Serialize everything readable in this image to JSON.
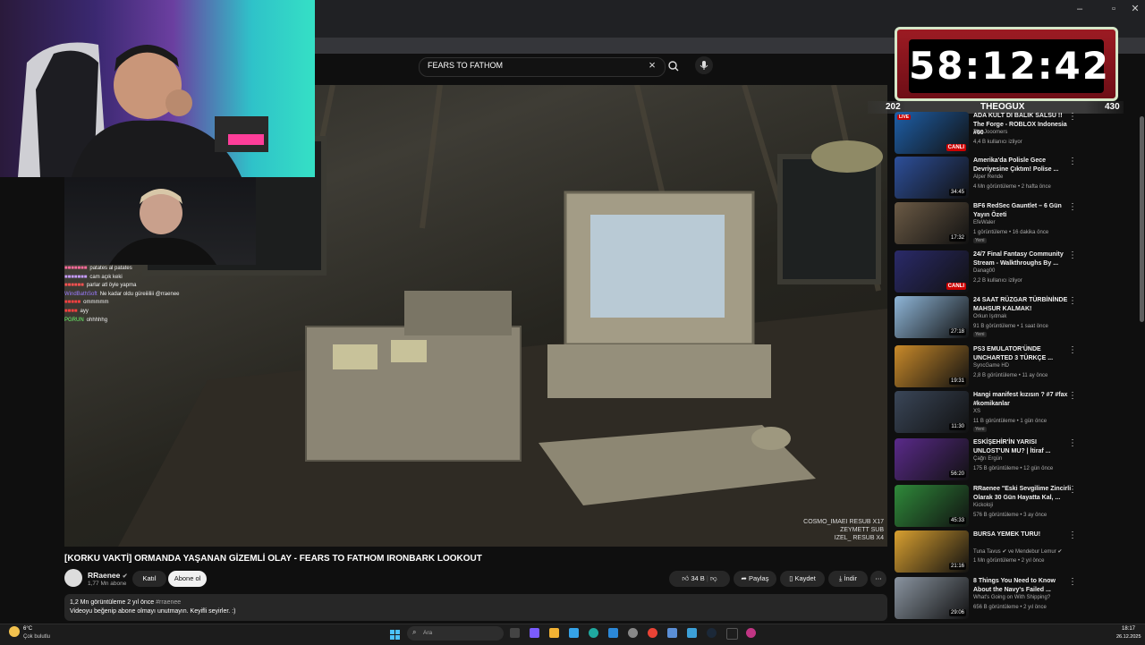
{
  "search": {
    "query": "FEARS TO FATHOM"
  },
  "timer": {
    "time": "58:12:42",
    "left_count": "202",
    "name": "THEOGUX",
    "right_count": "430"
  },
  "chat": [
    {
      "msg": "patates al patates"
    },
    {
      "msg": "cam açık keki"
    },
    {
      "msg": "parlar atl öyle yapma"
    },
    {
      "msg": "Ne kadar oldu güreiiiliii @rraenee",
      "user": "WindBathSoft"
    },
    {
      "msg": "ommmmm"
    },
    {
      "msg": "ayy"
    },
    {
      "msg": "ohhhhhg",
      "user": "PGRUN"
    }
  ],
  "video": {
    "title": "[KORKU VAKTİ] ORMANDA YAŞANAN GİZEMLİ OLAY - FEARS TO FATHOM IRONBARK LOOKOUT",
    "overlay_lines": [
      "COSMO_IMAEI  RESUB X17",
      "ZEYMETT  SUB",
      "IZEL_  RESUB X4"
    ]
  },
  "channel": {
    "name": "RRaenee",
    "subs": "1,77 Mn abone",
    "join": "Katıl",
    "subscribe": "Abone ol"
  },
  "actions": {
    "likes": "34 B",
    "share": "Paylaş",
    "save": "Kaydet",
    "download": "İndir",
    "more": "⋯"
  },
  "description": {
    "stats": "1,2 Mn görüntüleme  2 yıl önce",
    "hashtag": "#rraenee",
    "text": "Videoyu beğenip abone olmayı unutmayın. Keyifli seyirler. :)"
  },
  "recommendations": [
    {
      "title": "ADA KULT DI BALIK SALSU !! The Forge - ROBLOX Indonesia #60",
      "channel": "The Jooomers",
      "meta": "4,4 B kullanıcı izliyor",
      "badge_text": "CANLI",
      "live": true,
      "live_top": "LIVE",
      "thumb_color": "#1e5fa8"
    },
    {
      "title": "Amerika'da Polisle Gece Devriyesine Çıktım! Polise ...",
      "channel": "Alper Rende",
      "meta": "4 Mn görüntüleme • 2 hafta önce",
      "duration": "34:45",
      "thumb_color": "#2d4f9a"
    },
    {
      "title": "BF6  RedSec Gauntlet – 6  Gün Yayın Özeti",
      "channel": "EfeWaler",
      "meta": "1 görüntüleme • 16 dakika önce",
      "duration": "17:32",
      "badge": "Yeni",
      "thumb_color": "#6b5a45"
    },
    {
      "title": "24/7 Final Fantasy Community Stream - Walkthroughs By ...",
      "channel": "Danag00",
      "meta": "2,2 B kullanıcı izliyor",
      "badge_text": "CANLI",
      "live": true,
      "thumb_color": "#2a2a6a"
    },
    {
      "title": "24 SAAT RÜZGAR TÜRBİNİNDE MAHSUR KALMAK!",
      "channel": "Orkun Işıtmak",
      "meta": "91 B görüntüleme • 1 saat önce",
      "duration": "27:18",
      "badge": "Yeni",
      "thumb_color": "#8fb6d8"
    },
    {
      "title": "PS3 EMULATOR'ÜNDE UNCHARTED 3 TÜRKÇE ...",
      "channel": "SyncGame HD",
      "meta": "2,8 B görüntüleme • 11 ay önce",
      "duration": "19:31",
      "thumb_color": "#c98a2a"
    },
    {
      "title": "Hangi manifest kızısın ? #7 #fax #komikanlar",
      "channel": "XS",
      "meta": "11 B görüntüleme • 1 gün önce",
      "duration": "11:30",
      "badge": "Yeni",
      "thumb_color": "#3a4658"
    },
    {
      "title": "ESKİŞEHİR'İN YARISI UNLOST'UN MU? | İtiraf ...",
      "channel": "Çağrı Ergün",
      "meta": "175 B görüntüleme • 12 gün önce",
      "duration": "56:20",
      "thumb_color": "#5a2a8a"
    },
    {
      "title": "RRaenee \"Eski Sevgilime Zincirli Olarak 30 Gün Hayatta Kal, ...",
      "channel": "Kickoloji",
      "meta": "576 B görüntüleme • 3 ay önce",
      "duration": "45:33",
      "thumb_color": "#2f8a3a"
    },
    {
      "title": "BURSA YEMEK TURU!",
      "channel": "Tuna Tavus ✔ ve Mendebur Lemur ✔",
      "meta": "1 Mn görüntüleme • 2 yıl önce",
      "duration": "21:16",
      "thumb_color": "#d9a030"
    },
    {
      "title": "8 Things You Need to Know About the Navy's Failed ...",
      "channel": "What's Going on With Shipping?",
      "meta": "656 B görüntüleme • 2 yıl önce",
      "duration": "29:06",
      "thumb_color": "#8a94a0"
    }
  ],
  "taskbar": {
    "temp": "6°C",
    "condition": "Çok bulutlu",
    "search_placeholder": "Ara",
    "time": "18:17",
    "date": "26.12.2025"
  }
}
